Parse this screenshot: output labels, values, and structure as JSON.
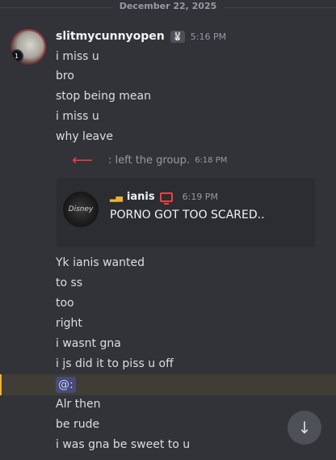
{
  "date_divider": "December 22, 2025",
  "author": {
    "username": "slitmycunnyopen",
    "tag_icon": "bunny-icon",
    "timestamp": "5:16 PM",
    "avatar_badge": "1"
  },
  "messages_a": [
    "i miss u",
    "bro",
    "stop being mean",
    "i miss u",
    "why leave"
  ],
  "system": {
    "arrow_icon": "left-arrow-icon",
    "text": ": left the group.",
    "time": "6:18 PM"
  },
  "embed": {
    "avatar_text": "Disney",
    "signal_icon": "signal-bars-icon",
    "username": "ianis",
    "device_icon": "monitor-icon",
    "time": "6:19 PM",
    "body": "PORNO GOT TOO SCARED.."
  },
  "messages_b": [
    "Yk ianis wanted",
    "to ss",
    "too",
    "right",
    "i wasnt gna",
    "i js did it to piss u off"
  ],
  "mention": "@:",
  "messages_c": [
    "Alr then",
    "be rude",
    "i was gna be sweet to u"
  ],
  "scroll_button_icon": "arrow-down-icon",
  "colors": {
    "background": "#313338",
    "username": "#f2f3f5",
    "message": "#dbdee1",
    "muted": "#949ba4",
    "red_accent": "#f23f42",
    "highlight_bar": "#f0b232",
    "mention_text": "#c9cdfb"
  }
}
